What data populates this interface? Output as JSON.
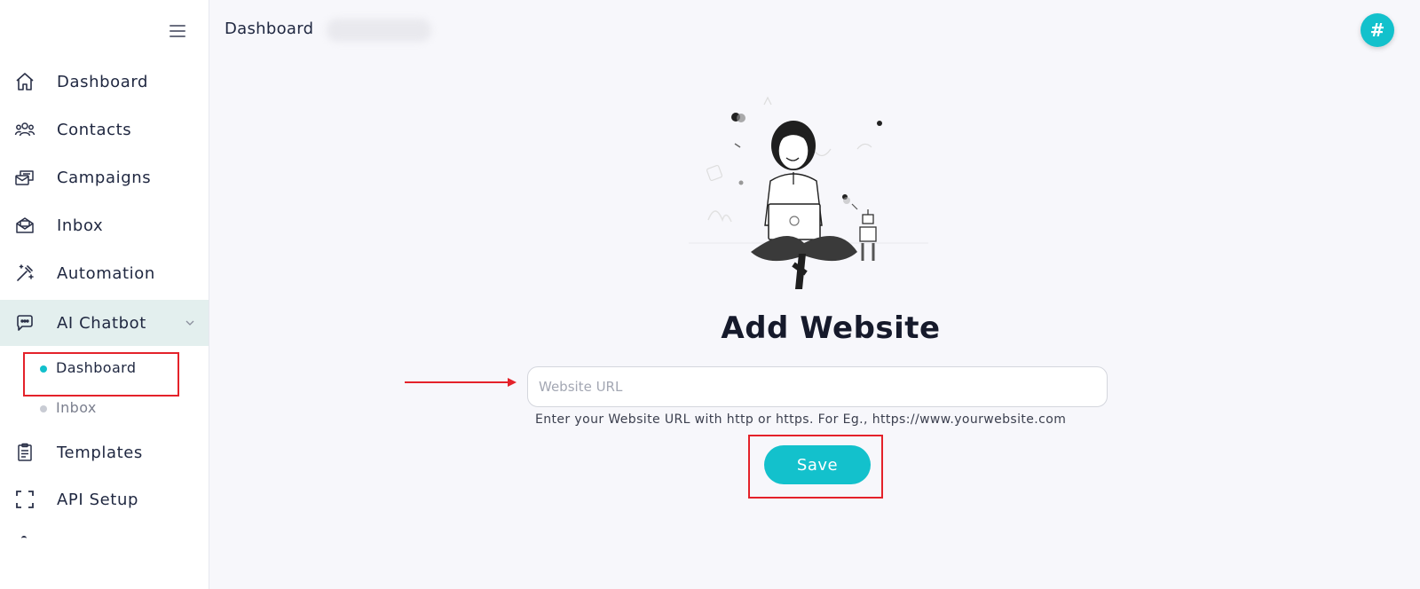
{
  "sidebar": {
    "items": [
      {
        "label": "Dashboard",
        "icon": "home-icon"
      },
      {
        "label": "Contacts",
        "icon": "contacts-icon"
      },
      {
        "label": "Campaigns",
        "icon": "campaigns-icon"
      },
      {
        "label": "Inbox",
        "icon": "inbox-icon"
      },
      {
        "label": "Automation",
        "icon": "automation-icon"
      },
      {
        "label": "AI Chatbot",
        "icon": "chat-icon"
      },
      {
        "label": "Templates",
        "icon": "clipboard-icon"
      },
      {
        "label": "API Setup",
        "icon": "api-frame-icon"
      }
    ],
    "submenu": [
      {
        "label": "Dashboard"
      },
      {
        "label": "Inbox"
      }
    ]
  },
  "header": {
    "breadcrumb": "Dashboard",
    "avatar_symbol": "#"
  },
  "main": {
    "title": "Add Website",
    "url_input": {
      "placeholder": "Website URL",
      "value": ""
    },
    "hint": "Enter your Website URL with http or https. For Eg., https://www.yourwebsite.com",
    "save_label": "Save"
  },
  "colors": {
    "accent": "#13c1cc",
    "active_bg": "#e3efee",
    "highlight_red": "#e4222a"
  }
}
